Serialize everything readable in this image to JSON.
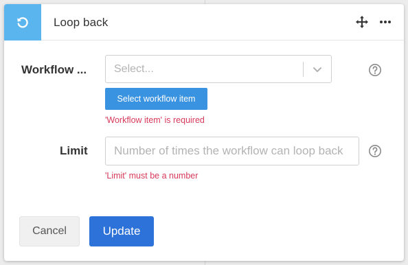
{
  "header": {
    "title": "Loop back",
    "icon": "loop-back-icon",
    "accent_color": "#5ab4ee"
  },
  "workflow_item": {
    "label": "Workflow ...",
    "placeholder": "Select...",
    "select_button_label": "Select workflow item",
    "error": "'Workflow item' is required"
  },
  "limit": {
    "label": "Limit",
    "placeholder": "Number of times the workflow can loop back",
    "value": "",
    "error": "'Limit' must be a number"
  },
  "footer": {
    "cancel_label": "Cancel",
    "update_label": "Update",
    "primary_color": "#2d72d9"
  },
  "colors": {
    "error": "#d8395a",
    "button_blue": "#3a93e1"
  }
}
